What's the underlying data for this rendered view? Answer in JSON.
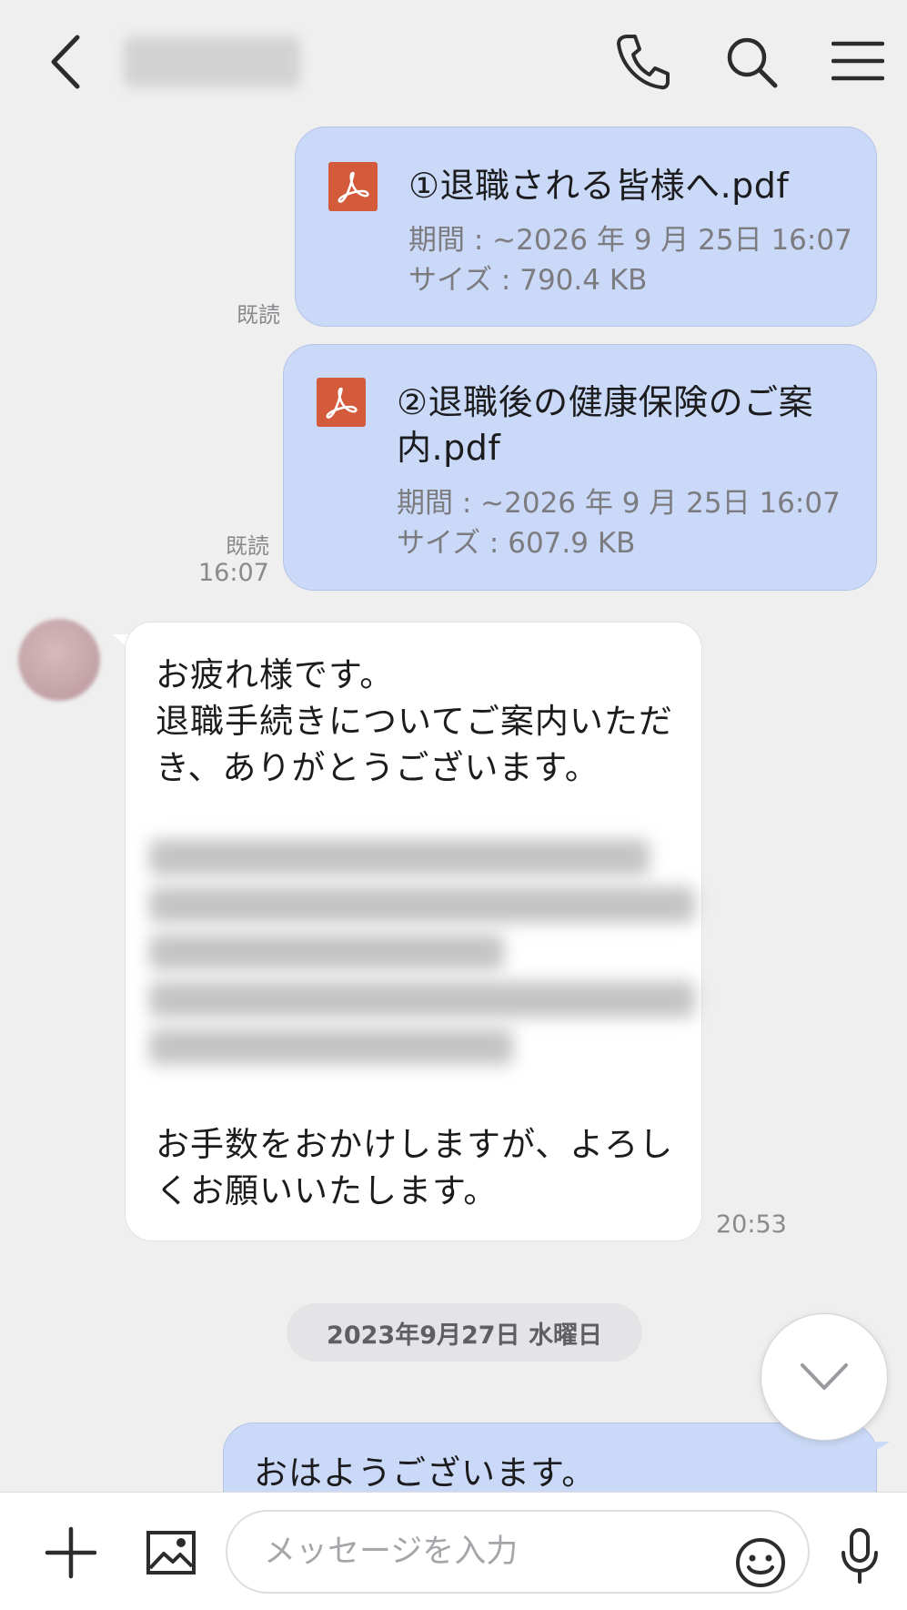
{
  "header": {
    "back_icon": "chevron-left-icon",
    "call_icon": "phone-icon",
    "search_icon": "search-icon",
    "menu_icon": "hamburger-menu-icon"
  },
  "files": [
    {
      "name": "①退職される皆様へ.pdf",
      "period": "期間 : ~2026 年 9 月 25日 16:07",
      "size": "サイズ : 790.4 KB",
      "read": "既読"
    },
    {
      "name": "②退職後の健康保険のご案内.pdf",
      "period": "期間 : ~2026 年 9 月 25日 16:07",
      "size": "サイズ : 607.9 KB",
      "read": "既読",
      "time": "16:07"
    }
  ],
  "received_message": {
    "text_top": "お疲れ様です。\n退職手続きについてご案内いただき、ありがとうございます。",
    "text_bottom": "お手数をおかけしますが、よろしくお願いいたします。",
    "time": "20:53"
  },
  "date_divider": "2023年9月27日 水曜日",
  "sent_message": {
    "text": "おはようございます。"
  },
  "composer": {
    "placeholder": "メッセージを入力",
    "add_icon": "plus-icon",
    "image_icon": "image-icon",
    "emoji_icon": "smiley-icon",
    "mic_icon": "microphone-icon"
  },
  "colors": {
    "background": "#efefef",
    "sent_bubble": "#cad9f7",
    "received_bubble": "#ffffff",
    "pdf_icon": "#d35a3b"
  }
}
